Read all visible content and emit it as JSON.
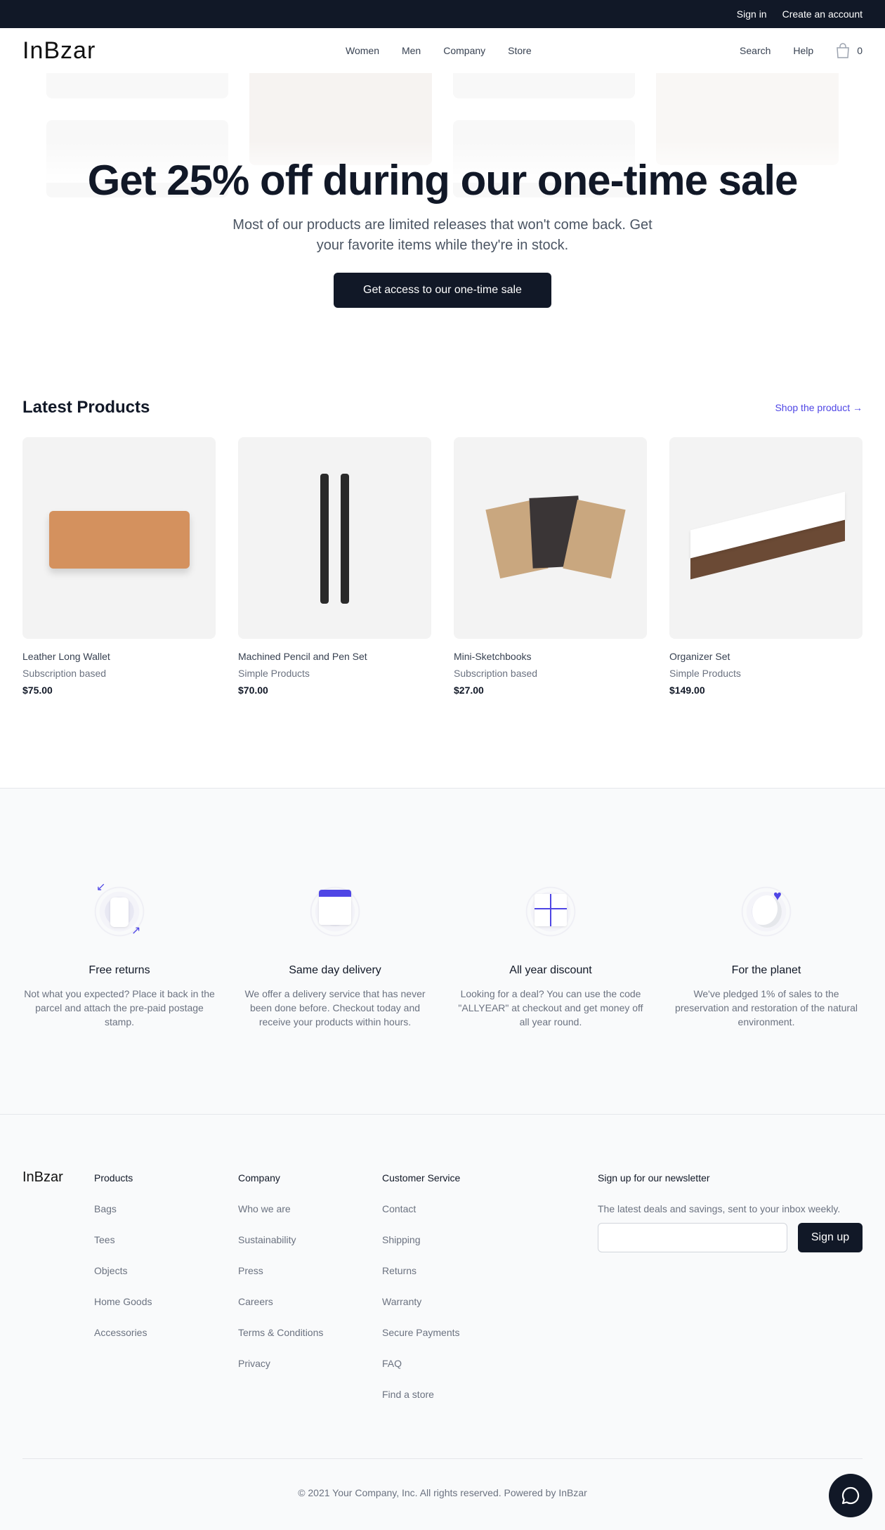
{
  "topbar": {
    "sign_in": "Sign in",
    "create_account": "Create an account"
  },
  "nav": {
    "logo": "InBzar",
    "links": [
      "Women",
      "Men",
      "Company",
      "Store"
    ],
    "search": "Search",
    "help": "Help",
    "cart_count": "0"
  },
  "hero": {
    "title": "Get 25% off during our one-time sale",
    "subtitle": "Most of our products are limited releases that won't come back. Get your favorite items while they're in stock.",
    "cta": "Get access to our one-time sale"
  },
  "products": {
    "title": "Latest Products",
    "shop_link": "Shop the product →",
    "items": [
      {
        "name": "Leather Long Wallet",
        "category": "Subscription based",
        "price": "$75.00"
      },
      {
        "name": "Machined Pencil and Pen Set",
        "category": "Simple Products",
        "price": "$70.00"
      },
      {
        "name": "Mini-Sketchbooks",
        "category": "Subscription based",
        "price": "$27.00"
      },
      {
        "name": "Organizer Set",
        "category": "Simple Products",
        "price": "$149.00"
      }
    ]
  },
  "features": [
    {
      "icon": "shirt-return-icon",
      "title": "Free returns",
      "desc": "Not what you expected? Place it back in the parcel and attach the pre-paid postage stamp."
    },
    {
      "icon": "calendar-icon",
      "title": "Same day delivery",
      "desc": "We offer a delivery service that has never been done before. Checkout today and receive your products within hours."
    },
    {
      "icon": "gift-card-icon",
      "title": "All year discount",
      "desc": "Looking for a deal? You can use the code \"ALLYEAR\" at checkout and get money off all year round."
    },
    {
      "icon": "planet-heart-icon",
      "title": "For the planet",
      "desc": "We've pledged 1% of sales to the preservation and restoration of the natural environment."
    }
  ],
  "footer": {
    "logo": "InBzar",
    "columns": [
      {
        "title": "Products",
        "links": [
          "Bags",
          "Tees",
          "Objects",
          "Home Goods",
          "Accessories"
        ]
      },
      {
        "title": "Company",
        "links": [
          "Who we are",
          "Sustainability",
          "Press",
          "Careers",
          "Terms & Conditions",
          "Privacy"
        ]
      },
      {
        "title": "Customer Service",
        "links": [
          "Contact",
          "Shipping",
          "Returns",
          "Warranty",
          "Secure Payments",
          "FAQ",
          "Find a store"
        ]
      }
    ],
    "newsletter": {
      "title": "Sign up for our newsletter",
      "desc": "The latest deals and savings, sent to your inbox weekly.",
      "button": "Sign up",
      "input_value": ""
    },
    "copyright": "© 2021 Your Company, Inc. All rights reserved. Powered by InBzar"
  },
  "colors": {
    "dark": "#111827",
    "accent": "#4f46e5"
  }
}
